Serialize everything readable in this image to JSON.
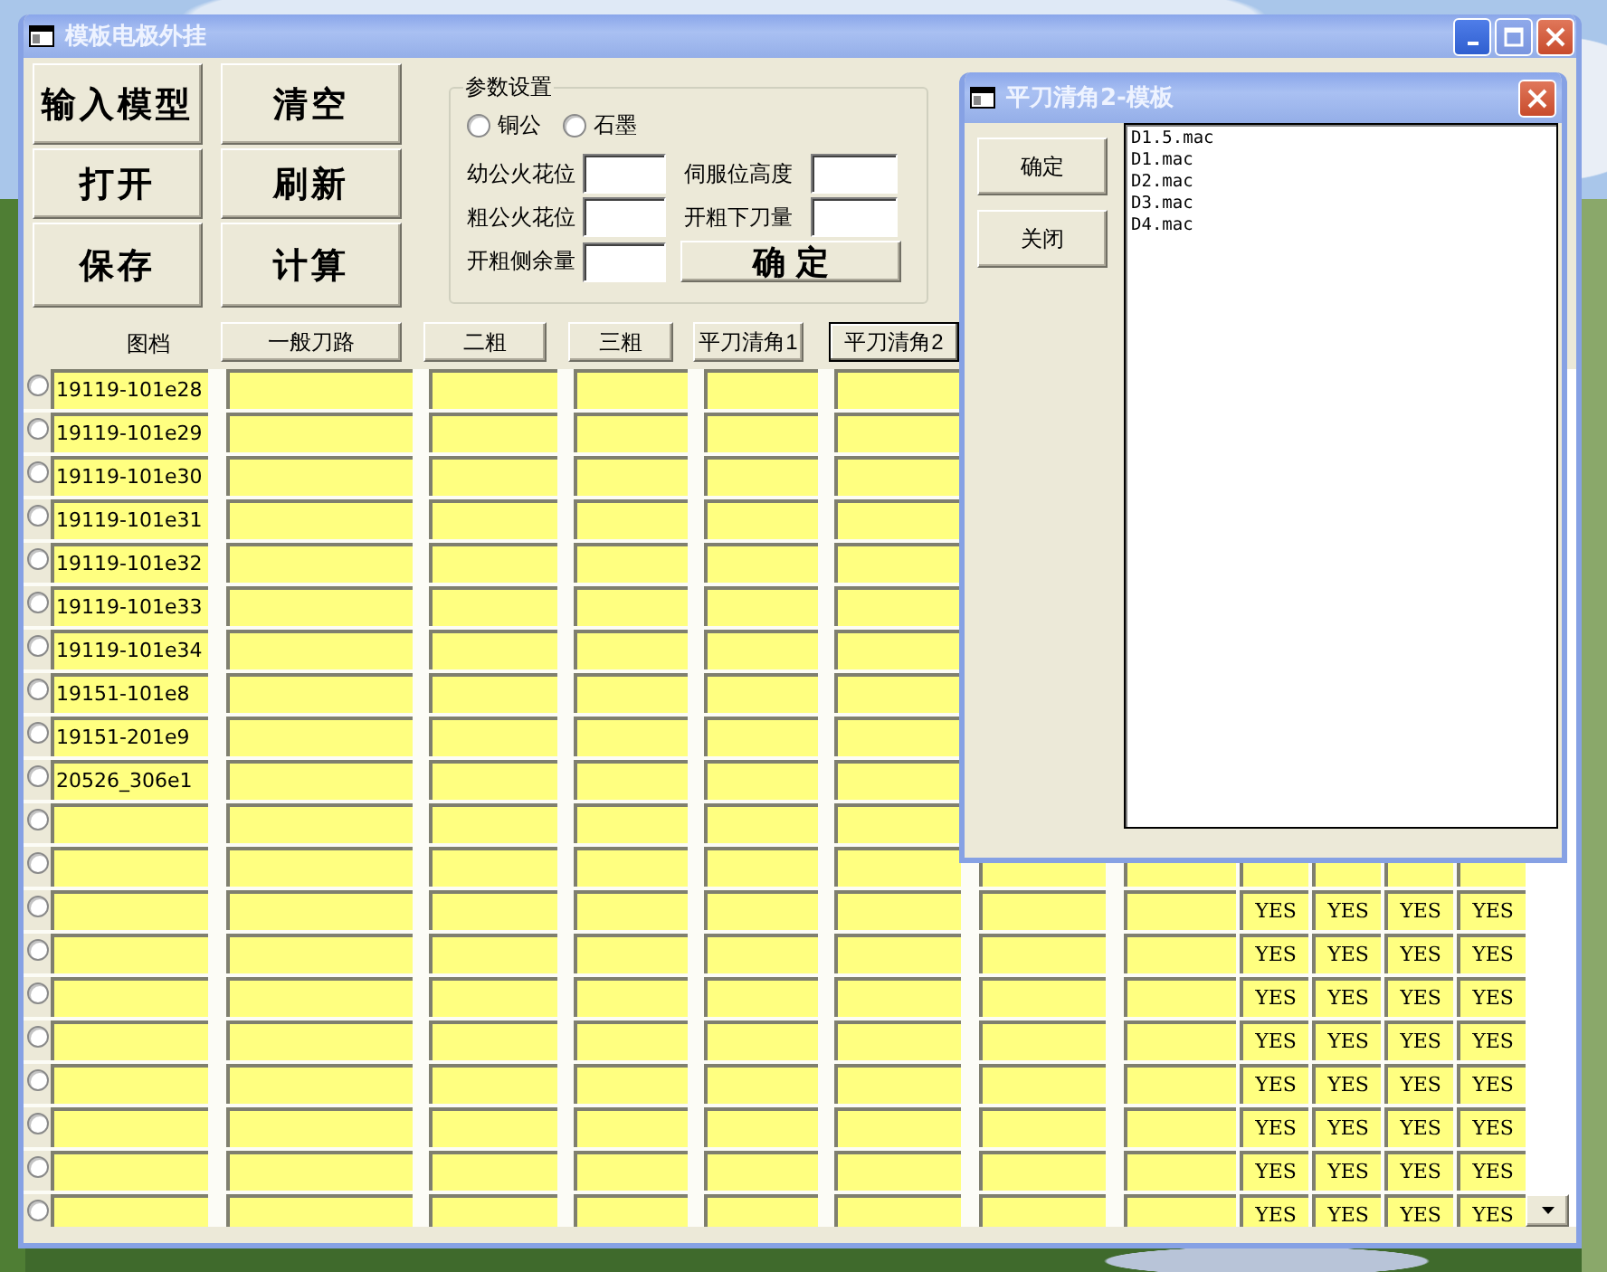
{
  "main_window": {
    "title": "模板电极外挂",
    "buttons": [
      {
        "label": "输入模型"
      },
      {
        "label": "清空"
      },
      {
        "label": "打开"
      },
      {
        "label": "刷新"
      },
      {
        "label": "保存"
      },
      {
        "label": "计算"
      }
    ],
    "parameters": {
      "title": "参数设置",
      "materials": [
        {
          "label": "铜公",
          "selected": false
        },
        {
          "label": "石墨",
          "selected": false
        }
      ],
      "fields": [
        {
          "label": "幼公火花位"
        },
        {
          "label": "伺服位高度"
        },
        {
          "label": "粗公火花位"
        },
        {
          "label": "开粗下刀量"
        },
        {
          "label": "开粗侧余量"
        }
      ],
      "confirm": "确 定"
    },
    "grid": {
      "file_header": "图档",
      "columns": [
        {
          "label": "一般刀路",
          "selected": false
        },
        {
          "label": "二粗",
          "selected": false
        },
        {
          "label": "三粗",
          "selected": false
        },
        {
          "label": "平刀清角1",
          "selected": false
        },
        {
          "label": "平刀清角2",
          "selected": true
        }
      ],
      "rows": [
        {
          "selected": false,
          "file": "19119-101e28"
        },
        {
          "selected": false,
          "file": "19119-101e29"
        },
        {
          "selected": false,
          "file": "19119-101e30"
        },
        {
          "selected": false,
          "file": "19119-101e31"
        },
        {
          "selected": false,
          "file": "19119-101e32"
        },
        {
          "selected": false,
          "file": "19119-101e33"
        },
        {
          "selected": false,
          "file": "19119-101e34"
        },
        {
          "selected": false,
          "file": "19151-101e8"
        },
        {
          "selected": false,
          "file": "19151-201e9"
        },
        {
          "selected": false,
          "file": "20526_306e1"
        },
        {
          "selected": false
        },
        {
          "selected": false
        },
        {
          "selected": false,
          "flags": [
            "YES",
            "YES",
            "YES",
            "YES"
          ]
        },
        {
          "selected": false,
          "flags": [
            "YES",
            "YES",
            "YES",
            "YES"
          ]
        },
        {
          "selected": false,
          "flags": [
            "YES",
            "YES",
            "YES",
            "YES"
          ]
        },
        {
          "selected": false,
          "flags": [
            "YES",
            "YES",
            "YES",
            "YES"
          ]
        },
        {
          "selected": false,
          "flags": [
            "YES",
            "YES",
            "YES",
            "YES"
          ]
        },
        {
          "selected": false,
          "flags": [
            "YES",
            "YES",
            "YES",
            "YES"
          ]
        },
        {
          "selected": false,
          "flags": [
            "YES",
            "YES",
            "YES",
            "YES"
          ]
        },
        {
          "selected": false,
          "flags": [
            "YES",
            "YES",
            "YES",
            "YES"
          ]
        }
      ]
    }
  },
  "dialog": {
    "title": "平刀清角2-模板",
    "buttons": [
      {
        "label": "确定"
      },
      {
        "label": "关闭"
      }
    ],
    "list": [
      "D1.5.mac",
      "D1.mac",
      "D2.mac",
      "D3.mac",
      "D4.mac"
    ]
  }
}
